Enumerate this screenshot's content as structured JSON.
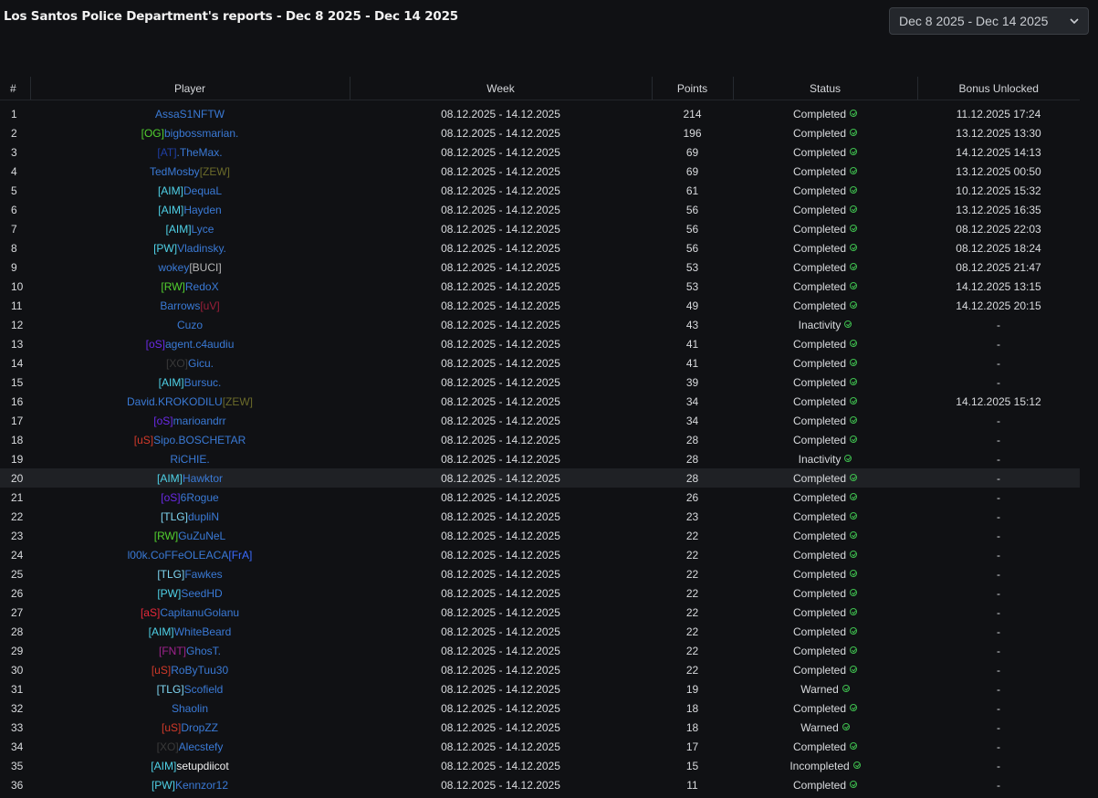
{
  "header": {
    "title": "Los Santos Police Department's reports - Dec 8 2025 - Dec 14 2025",
    "range_select": "Dec 8 2025 - Dec 14 2025"
  },
  "table": {
    "columns": [
      "#",
      "Player",
      "Week",
      "Points",
      "Status",
      "Bonus Unlocked"
    ],
    "rows": [
      {
        "n": "1",
        "tag": "",
        "tag_color": "",
        "name": "AssaS1NFTW",
        "suffix": "",
        "suffix_color": "",
        "week": "08.12.2025 - 14.12.2025",
        "points": "214",
        "status": "Completed",
        "bonus": "11.12.2025 17:24"
      },
      {
        "n": "2",
        "tag": "[OG]",
        "tag_color": "#52d12f",
        "name": "bigbossmarian.",
        "suffix": "",
        "suffix_color": "",
        "week": "08.12.2025 - 14.12.2025",
        "points": "196",
        "status": "Completed",
        "bonus": "13.12.2025 13:30"
      },
      {
        "n": "3",
        "tag": "[AT]",
        "tag_color": "#1f3fa6",
        "name": ".TheMax.",
        "suffix": "",
        "suffix_color": "",
        "week": "08.12.2025 - 14.12.2025",
        "points": "69",
        "status": "Completed",
        "bonus": "14.12.2025 14:13"
      },
      {
        "n": "4",
        "tag": "",
        "tag_color": "",
        "name": "TedMosby",
        "suffix": "[ZEW]",
        "suffix_color": "#6b6b2a",
        "week": "08.12.2025 - 14.12.2025",
        "points": "69",
        "status": "Completed",
        "bonus": "13.12.2025 00:50"
      },
      {
        "n": "5",
        "tag": "[AIM]",
        "tag_color": "#4fd2e8",
        "name": "DequaL",
        "suffix": "",
        "suffix_color": "",
        "week": "08.12.2025 - 14.12.2025",
        "points": "61",
        "status": "Completed",
        "bonus": "10.12.2025 15:32"
      },
      {
        "n": "6",
        "tag": "[AIM]",
        "tag_color": "#4fd2e8",
        "name": "Hayden",
        "suffix": "",
        "suffix_color": "",
        "week": "08.12.2025 - 14.12.2025",
        "points": "56",
        "status": "Completed",
        "bonus": "13.12.2025 16:35"
      },
      {
        "n": "7",
        "tag": "[AIM]",
        "tag_color": "#4fd2e8",
        "name": "Lyce",
        "suffix": "",
        "suffix_color": "",
        "week": "08.12.2025 - 14.12.2025",
        "points": "56",
        "status": "Completed",
        "bonus": "08.12.2025 22:03"
      },
      {
        "n": "8",
        "tag": "[PW]",
        "tag_color": "#4fd2e8",
        "name": "Vladinsky.",
        "suffix": "",
        "suffix_color": "",
        "week": "08.12.2025 - 14.12.2025",
        "points": "56",
        "status": "Completed",
        "bonus": "08.12.2025 18:24"
      },
      {
        "n": "9",
        "tag": "",
        "tag_color": "",
        "name": "wokey",
        "suffix": "[BUCI]",
        "suffix_color": "#b8b8b8",
        "week": "08.12.2025 - 14.12.2025",
        "points": "53",
        "status": "Completed",
        "bonus": "08.12.2025 21:47"
      },
      {
        "n": "10",
        "tag": "[RW]",
        "tag_color": "#52d12f",
        "name": "RedoX",
        "suffix": "",
        "suffix_color": "",
        "week": "08.12.2025 - 14.12.2025",
        "points": "53",
        "status": "Completed",
        "bonus": "14.12.2025 13:15"
      },
      {
        "n": "11",
        "tag": "",
        "tag_color": "",
        "name": "Barrows",
        "suffix": "[uV]",
        "suffix_color": "#9c1f3a",
        "week": "08.12.2025 - 14.12.2025",
        "points": "49",
        "status": "Completed",
        "bonus": "14.12.2025 20:15"
      },
      {
        "n": "12",
        "tag": "",
        "tag_color": "",
        "name": "Cuzo",
        "suffix": "",
        "suffix_color": "",
        "week": "08.12.2025 - 14.12.2025",
        "points": "43",
        "status": "Inactivity",
        "bonus": "-"
      },
      {
        "n": "13",
        "tag": "[oS]",
        "tag_color": "#6b2ae8",
        "name": "agent.c4audiu",
        "suffix": "",
        "suffix_color": "",
        "week": "08.12.2025 - 14.12.2025",
        "points": "41",
        "status": "Completed",
        "bonus": "-"
      },
      {
        "n": "14",
        "tag": "[XO]",
        "tag_color": "#3a3a3a",
        "name": "Gicu.",
        "suffix": "",
        "suffix_color": "",
        "week": "08.12.2025 - 14.12.2025",
        "points": "41",
        "status": "Completed",
        "bonus": "-"
      },
      {
        "n": "15",
        "tag": "[AIM]",
        "tag_color": "#4fd2e8",
        "name": "Bursuc.",
        "suffix": "",
        "suffix_color": "",
        "week": "08.12.2025 - 14.12.2025",
        "points": "39",
        "status": "Completed",
        "bonus": "-"
      },
      {
        "n": "16",
        "tag": "",
        "tag_color": "",
        "name": "David.KROKODILU",
        "suffix": "[ZEW]",
        "suffix_color": "#6b6b2a",
        "week": "08.12.2025 - 14.12.2025",
        "points": "34",
        "status": "Completed",
        "bonus": "14.12.2025 15:12"
      },
      {
        "n": "17",
        "tag": "[oS]",
        "tag_color": "#6b2ae8",
        "name": "marioandrr",
        "suffix": "",
        "suffix_color": "",
        "week": "08.12.2025 - 14.12.2025",
        "points": "34",
        "status": "Completed",
        "bonus": "-"
      },
      {
        "n": "18",
        "tag": "[uS]",
        "tag_color": "#d23a2a",
        "name": "Sipo.BOSCHETAR",
        "suffix": "",
        "suffix_color": "",
        "week": "08.12.2025 - 14.12.2025",
        "points": "28",
        "status": "Completed",
        "bonus": "-"
      },
      {
        "n": "19",
        "tag": "",
        "tag_color": "",
        "name": "RiCHIE.",
        "suffix": "",
        "suffix_color": "",
        "week": "08.12.2025 - 14.12.2025",
        "points": "28",
        "status": "Inactivity",
        "bonus": "-"
      },
      {
        "n": "20",
        "tag": "[AIM]",
        "tag_color": "#4fd2e8",
        "name": "Hawktor",
        "suffix": "",
        "suffix_color": "",
        "week": "08.12.2025 - 14.12.2025",
        "points": "28",
        "status": "Completed",
        "bonus": "-"
      },
      {
        "n": "21",
        "tag": "[oS]",
        "tag_color": "#6b2ae8",
        "name": "6Rogue",
        "suffix": "",
        "suffix_color": "",
        "week": "08.12.2025 - 14.12.2025",
        "points": "26",
        "status": "Completed",
        "bonus": "-"
      },
      {
        "n": "22",
        "tag": "[TLG]",
        "tag_color": "#7fd6f2",
        "name": "dupliN",
        "suffix": "",
        "suffix_color": "",
        "week": "08.12.2025 - 14.12.2025",
        "points": "23",
        "status": "Completed",
        "bonus": "-"
      },
      {
        "n": "23",
        "tag": "[RW]",
        "tag_color": "#52d12f",
        "name": "GuZuNeL",
        "suffix": "",
        "suffix_color": "",
        "week": "08.12.2025 - 14.12.2025",
        "points": "22",
        "status": "Completed",
        "bonus": "-"
      },
      {
        "n": "24",
        "tag": "",
        "tag_color": "",
        "name": "l00k.CoFFeOLEACA",
        "suffix": "[FrA]",
        "suffix_color": "#3b6bff",
        "week": "08.12.2025 - 14.12.2025",
        "points": "22",
        "status": "Completed",
        "bonus": "-"
      },
      {
        "n": "25",
        "tag": "[TLG]",
        "tag_color": "#7fd6f2",
        "name": "Fawkes",
        "suffix": "",
        "suffix_color": "",
        "week": "08.12.2025 - 14.12.2025",
        "points": "22",
        "status": "Completed",
        "bonus": "-"
      },
      {
        "n": "26",
        "tag": "[PW]",
        "tag_color": "#4fd2e8",
        "name": "SeedHD",
        "suffix": "",
        "suffix_color": "",
        "week": "08.12.2025 - 14.12.2025",
        "points": "22",
        "status": "Completed",
        "bonus": "-"
      },
      {
        "n": "27",
        "tag": "[aS]",
        "tag_color": "#e8283a",
        "name": "CapitanuGolanu",
        "suffix": "",
        "suffix_color": "",
        "week": "08.12.2025 - 14.12.2025",
        "points": "22",
        "status": "Completed",
        "bonus": "-"
      },
      {
        "n": "28",
        "tag": "[AIM]",
        "tag_color": "#4fd2e8",
        "name": "WhiteBeard",
        "suffix": "",
        "suffix_color": "",
        "week": "08.12.2025 - 14.12.2025",
        "points": "22",
        "status": "Completed",
        "bonus": "-"
      },
      {
        "n": "29",
        "tag": "[FNT]",
        "tag_color": "#a0228e",
        "name": "GhosT.",
        "suffix": "",
        "suffix_color": "",
        "week": "08.12.2025 - 14.12.2025",
        "points": "22",
        "status": "Completed",
        "bonus": "-"
      },
      {
        "n": "30",
        "tag": "[uS]",
        "tag_color": "#d23a2a",
        "name": "RoByTuu30",
        "suffix": "",
        "suffix_color": "",
        "week": "08.12.2025 - 14.12.2025",
        "points": "22",
        "status": "Completed",
        "bonus": "-"
      },
      {
        "n": "31",
        "tag": "[TLG]",
        "tag_color": "#7fd6f2",
        "name": "Scofield",
        "suffix": "",
        "suffix_color": "",
        "week": "08.12.2025 - 14.12.2025",
        "points": "19",
        "status": "Warned",
        "bonus": "-"
      },
      {
        "n": "32",
        "tag": "",
        "tag_color": "",
        "name": "Shaolin",
        "suffix": "",
        "suffix_color": "",
        "week": "08.12.2025 - 14.12.2025",
        "points": "18",
        "status": "Completed",
        "bonus": "-"
      },
      {
        "n": "33",
        "tag": "[uS]",
        "tag_color": "#d23a2a",
        "name": "DropZZ",
        "suffix": "",
        "suffix_color": "",
        "week": "08.12.2025 - 14.12.2025",
        "points": "18",
        "status": "Warned",
        "bonus": "-"
      },
      {
        "n": "34",
        "tag": "[XO]",
        "tag_color": "#3a3a3a",
        "name": "Alecstefy",
        "suffix": "",
        "suffix_color": "",
        "week": "08.12.2025 - 14.12.2025",
        "points": "17",
        "status": "Completed",
        "bonus": "-"
      },
      {
        "n": "35",
        "tag": "[AIM]",
        "tag_color": "#4fd2e8",
        "name": "setupdiicot",
        "name_color": "#f0f0f0",
        "suffix": "",
        "suffix_color": "",
        "week": "08.12.2025 - 14.12.2025",
        "points": "15",
        "status": "Incompleted",
        "bonus": "-"
      },
      {
        "n": "36",
        "tag": "[PW]",
        "tag_color": "#4fd2e8",
        "name": "Kennzor12",
        "suffix": "",
        "suffix_color": "",
        "week": "08.12.2025 - 14.12.2025",
        "points": "11",
        "status": "Completed",
        "bonus": "-"
      }
    ],
    "highlighted_row": "20"
  },
  "colors": {
    "background": "#101114",
    "player_name": "#3a7ad6",
    "status_icon": "#3fbf4f"
  },
  "icons": {
    "status_icon": "check-circle-icon",
    "select_chevron": "chevron-down-icon"
  }
}
